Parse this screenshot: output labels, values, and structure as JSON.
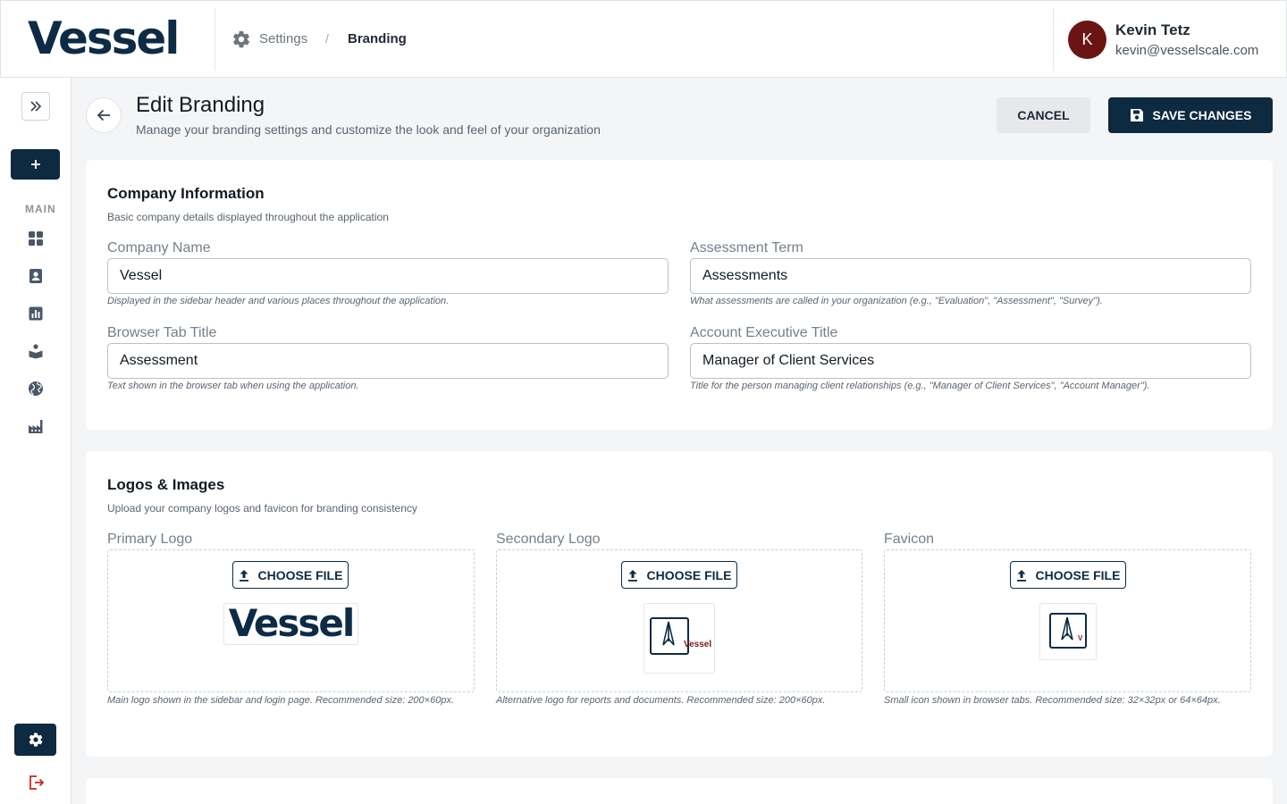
{
  "header": {
    "brand": "Vessel",
    "breadcrumb": {
      "settings": "Settings",
      "separator": "/",
      "current": "Branding"
    },
    "user": {
      "initial": "K",
      "name": "Kevin Tetz",
      "email": "kevin@vesselscale.com",
      "avatar_color": "#6b1414"
    }
  },
  "sidebar": {
    "section_label": "MAIN",
    "icons": [
      "dashboard-icon",
      "contacts-icon",
      "analytics-icon",
      "learning-icon",
      "globe-icon",
      "factory-icon"
    ],
    "accent": "#0e2a40",
    "logout_color": "#c62828"
  },
  "page": {
    "title": "Edit Branding",
    "subtitle": "Manage your branding settings and customize the look and feel of your organization",
    "cancel_label": "CANCEL",
    "save_label": "SAVE CHANGES"
  },
  "company_info": {
    "title": "Company Information",
    "subtitle": "Basic company details displayed throughout the application",
    "fields": {
      "company_name": {
        "label": "Company Name",
        "value": "Vessel",
        "help": "Displayed in the sidebar header and various places throughout the application."
      },
      "assessment_term": {
        "label": "Assessment Term",
        "value": "Assessments",
        "help": "What assessments are called in your organization (e.g., \"Evaluation\", \"Assessment\", \"Survey\")."
      },
      "browser_title": {
        "label": "Browser Tab Title",
        "value": "Assessment",
        "help": "Text shown in the browser tab when using the application."
      },
      "account_exec": {
        "label": "Account Executive Title",
        "value": "Manager of Client Services",
        "help": "Title for the person managing client relationships (e.g., \"Manager of Client Services\", \"Account Manager\")."
      }
    }
  },
  "logos": {
    "title": "Logos & Images",
    "subtitle": "Upload your company logos and favicon for branding consistency",
    "choose_label": "CHOOSE FILE",
    "primary": {
      "label": "Primary Logo",
      "preview_text": "Vessel",
      "help": "Main logo shown in the sidebar and login page. Recommended size: 200×60px."
    },
    "secondary": {
      "label": "Secondary Logo",
      "preview_text": "Vessel",
      "help": "Alternative logo for reports and documents. Recommended size: 200×60px."
    },
    "favicon": {
      "label": "Favicon",
      "preview_text": "V",
      "help": "Small icon shown in browser tabs. Recommended size: 32×32px or 64×64px."
    }
  }
}
